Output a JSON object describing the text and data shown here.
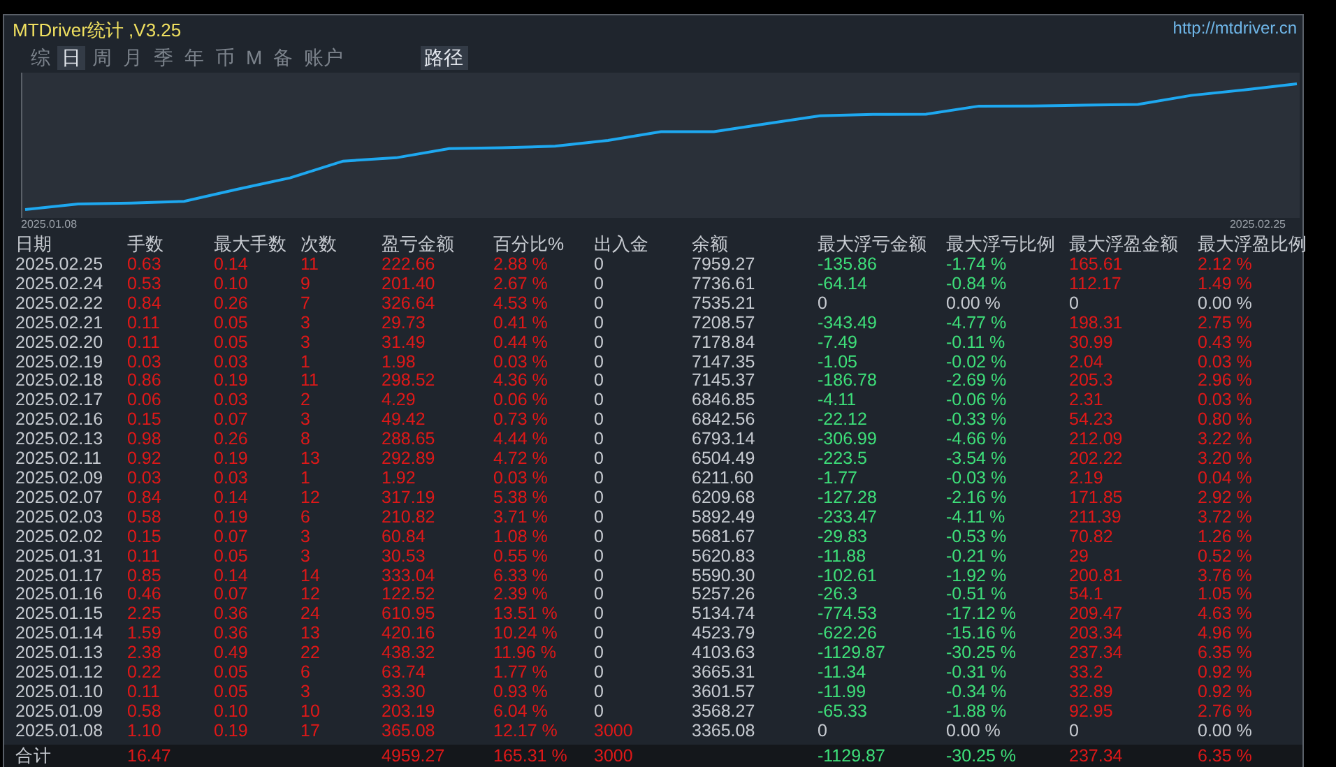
{
  "window": {
    "title": "MTDriver统计 ,V3.25",
    "link": "http://mtdriver.cn"
  },
  "tabs": [
    {
      "label": "综",
      "selected": false
    },
    {
      "label": "日",
      "selected": true
    },
    {
      "label": "周",
      "selected": false
    },
    {
      "label": "月",
      "selected": false
    },
    {
      "label": "季",
      "selected": false
    },
    {
      "label": "年",
      "selected": false
    },
    {
      "label": "币",
      "selected": false
    },
    {
      "label": "M",
      "selected": false
    },
    {
      "label": "备",
      "selected": false
    },
    {
      "label": "账户",
      "selected": false
    }
  ],
  "path_button": {
    "label": "路径"
  },
  "equity_chart": {
    "start_label": "2025.01.08",
    "end_label": "2025.02.25"
  },
  "table": {
    "columns": [
      {
        "label": "日期",
        "color": "#c8ccd2"
      },
      {
        "label": "手数",
        "color": "#e01818"
      },
      {
        "label": "最大手数",
        "color": "#e01818"
      },
      {
        "label": "次数",
        "color": "#e01818"
      },
      {
        "label": "盈亏金额",
        "color": "#e01818"
      },
      {
        "label": "百分比%",
        "color": "#e01818"
      },
      {
        "label": "出入金",
        "color": "#e01818"
      },
      {
        "label": "余额",
        "color": "#c8ccd2"
      },
      {
        "label": "最大浮亏金额",
        "color": "#3ee07a"
      },
      {
        "label": "最大浮亏比例",
        "color": "#3ee07a"
      },
      {
        "label": "最大浮盈金额",
        "color": "#e01818"
      },
      {
        "label": "最大浮盈比例",
        "color": "#e01818"
      }
    ],
    "rows": [
      [
        "2025.02.25",
        "0.63",
        "0.14",
        "11",
        "222.66",
        "2.88 %",
        "0",
        "7959.27",
        "-135.86",
        "-1.74 %",
        "165.61",
        "2.12 %"
      ],
      [
        "2025.02.24",
        "0.53",
        "0.10",
        "9",
        "201.40",
        "2.67 %",
        "0",
        "7736.61",
        "-64.14",
        "-0.84 %",
        "112.17",
        "1.49 %"
      ],
      [
        "2025.02.22",
        "0.84",
        "0.26",
        "7",
        "326.64",
        "4.53 %",
        "0",
        "7535.21",
        "0",
        "0.00 %",
        "0",
        "0.00 %"
      ],
      [
        "2025.02.21",
        "0.11",
        "0.05",
        "3",
        "29.73",
        "0.41 %",
        "0",
        "7208.57",
        "-343.49",
        "-4.77 %",
        "198.31",
        "2.75 %"
      ],
      [
        "2025.02.20",
        "0.11",
        "0.05",
        "3",
        "31.49",
        "0.44 %",
        "0",
        "7178.84",
        "-7.49",
        "-0.11 %",
        "30.99",
        "0.43 %"
      ],
      [
        "2025.02.19",
        "0.03",
        "0.03",
        "1",
        "1.98",
        "0.03 %",
        "0",
        "7147.35",
        "-1.05",
        "-0.02 %",
        "2.04",
        "0.03 %"
      ],
      [
        "2025.02.18",
        "0.86",
        "0.19",
        "11",
        "298.52",
        "4.36 %",
        "0",
        "7145.37",
        "-186.78",
        "-2.69 %",
        "205.3",
        "2.96 %"
      ],
      [
        "2025.02.17",
        "0.06",
        "0.03",
        "2",
        "4.29",
        "0.06 %",
        "0",
        "6846.85",
        "-4.11",
        "-0.06 %",
        "2.31",
        "0.03 %"
      ],
      [
        "2025.02.16",
        "0.15",
        "0.07",
        "3",
        "49.42",
        "0.73 %",
        "0",
        "6842.56",
        "-22.12",
        "-0.33 %",
        "54.23",
        "0.80 %"
      ],
      [
        "2025.02.13",
        "0.98",
        "0.26",
        "8",
        "288.65",
        "4.44 %",
        "0",
        "6793.14",
        "-306.99",
        "-4.66 %",
        "212.09",
        "3.22 %"
      ],
      [
        "2025.02.11",
        "0.92",
        "0.19",
        "13",
        "292.89",
        "4.72 %",
        "0",
        "6504.49",
        "-223.5",
        "-3.54 %",
        "202.22",
        "3.20 %"
      ],
      [
        "2025.02.09",
        "0.03",
        "0.03",
        "1",
        "1.92",
        "0.03 %",
        "0",
        "6211.60",
        "-1.77",
        "-0.03 %",
        "2.19",
        "0.04 %"
      ],
      [
        "2025.02.07",
        "0.84",
        "0.14",
        "12",
        "317.19",
        "5.38 %",
        "0",
        "6209.68",
        "-127.28",
        "-2.16 %",
        "171.85",
        "2.92 %"
      ],
      [
        "2025.02.03",
        "0.58",
        "0.19",
        "6",
        "210.82",
        "3.71 %",
        "0",
        "5892.49",
        "-233.47",
        "-4.11 %",
        "211.39",
        "3.72 %"
      ],
      [
        "2025.02.02",
        "0.15",
        "0.07",
        "3",
        "60.84",
        "1.08 %",
        "0",
        "5681.67",
        "-29.83",
        "-0.53 %",
        "70.82",
        "1.26 %"
      ],
      [
        "2025.01.31",
        "0.11",
        "0.05",
        "3",
        "30.53",
        "0.55 %",
        "0",
        "5620.83",
        "-11.88",
        "-0.21 %",
        "29",
        "0.52 %"
      ],
      [
        "2025.01.17",
        "0.85",
        "0.14",
        "14",
        "333.04",
        "6.33 %",
        "0",
        "5590.30",
        "-102.61",
        "-1.92 %",
        "200.81",
        "3.76 %"
      ],
      [
        "2025.01.16",
        "0.46",
        "0.07",
        "12",
        "122.52",
        "2.39 %",
        "0",
        "5257.26",
        "-26.3",
        "-0.51 %",
        "54.1",
        "1.05 %"
      ],
      [
        "2025.01.15",
        "2.25",
        "0.36",
        "24",
        "610.95",
        "13.51 %",
        "0",
        "5134.74",
        "-774.53",
        "-17.12 %",
        "209.47",
        "4.63 %"
      ],
      [
        "2025.01.14",
        "1.59",
        "0.36",
        "13",
        "420.16",
        "10.24 %",
        "0",
        "4523.79",
        "-622.26",
        "-15.16 %",
        "203.34",
        "4.96 %"
      ],
      [
        "2025.01.13",
        "2.38",
        "0.49",
        "22",
        "438.32",
        "11.96 %",
        "0",
        "4103.63",
        "-1129.87",
        "-30.25 %",
        "237.34",
        "6.35 %"
      ],
      [
        "2025.01.12",
        "0.22",
        "0.05",
        "6",
        "63.74",
        "1.77 %",
        "0",
        "3665.31",
        "-11.34",
        "-0.31 %",
        "33.2",
        "0.92 %"
      ],
      [
        "2025.01.10",
        "0.11",
        "0.05",
        "3",
        "33.30",
        "0.93 %",
        "0",
        "3601.57",
        "-11.99",
        "-0.34 %",
        "32.89",
        "0.92 %"
      ],
      [
        "2025.01.09",
        "0.58",
        "0.10",
        "10",
        "203.19",
        "6.04 %",
        "0",
        "3568.27",
        "-65.33",
        "-1.88 %",
        "92.95",
        "2.76 %"
      ],
      [
        "2025.01.08",
        "1.10",
        "0.19",
        "17",
        "365.08",
        "12.17 %",
        "3000",
        "3365.08",
        "0",
        "0.00 %",
        "0",
        "0.00 %"
      ]
    ],
    "total": {
      "label": "合计",
      "lots": "16.47",
      "profit": "4959.27",
      "percent": "165.31 %",
      "deposit": "3000",
      "max_float_loss": "-1129.87",
      "max_float_loss_pct": "-30.25 %",
      "max_float_profit": "237.34",
      "max_float_profit_pct": "6.35 %"
    }
  }
}
